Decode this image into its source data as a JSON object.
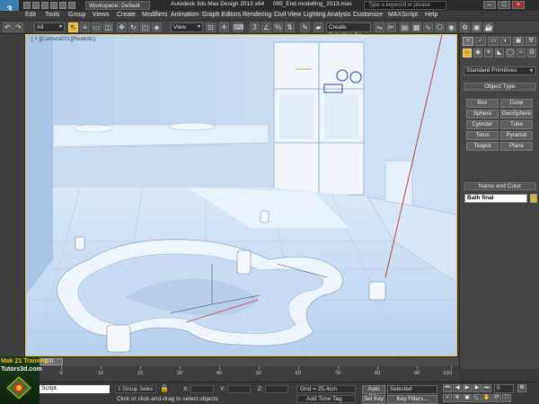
{
  "titlebar": {
    "logo": "3",
    "workspace": "Workspace: Default",
    "app_title": "Autodesk 3ds Max Design 2013 x64",
    "file_name": "095_End modelling_2013.max",
    "search_placeholder": "Type a keyword or phrase"
  },
  "menu": [
    "Edit",
    "Tools",
    "Group",
    "Views",
    "Create",
    "Modifiers",
    "Animation",
    "Graph Editors",
    "Rendering",
    "Civil View",
    "Lighting Analysis",
    "Customize",
    "MAXScript",
    "Help"
  ],
  "toolbar": {
    "filter": "All",
    "ref_coord": "View",
    "selection_set": "Create Selection Se"
  },
  "viewport": {
    "label": "[ + ][Camera001][Realistic]"
  },
  "command_panel": {
    "tabs": [
      "+",
      "⌐",
      "▭",
      "◐",
      "▣",
      "⚒"
    ],
    "category_icons": [
      "○",
      "◉",
      "☀",
      "◣",
      "◯",
      "≈",
      "⚙"
    ],
    "dropdown": "Standard Primitives",
    "object_type_title": "Object Type",
    "autogrid": "AutoGrid",
    "buttons": [
      [
        "Box",
        "Cone"
      ],
      [
        "Sphere",
        "GeoSphere"
      ],
      [
        "Cylinder",
        "Tube"
      ],
      [
        "Torus",
        "Pyramid"
      ],
      [
        "Teapot",
        "Plane"
      ]
    ],
    "name_color_title": "Name and Color",
    "object_name": "Bath final",
    "swatch_color": "#d9b23a"
  },
  "timeline": {
    "slider": "0 / 100",
    "ticks": [
      "0",
      "10",
      "20",
      "30",
      "40",
      "50",
      "60",
      "70",
      "80",
      "90",
      "100"
    ]
  },
  "status": {
    "maxscript": "Script.",
    "selection": "1 Group Selec",
    "x_label": "X:",
    "y_label": "Y:",
    "z_label": "Z:",
    "grid": "Grid = 25,4cm",
    "prompt": "Click or click-and-drag to select objects",
    "add_time_tag": "Add Time Tag",
    "auto_key": "Auto Key",
    "selected": "Selected",
    "set_key": "Set Key",
    "key_filters": "Key Filters...",
    "frame": "0"
  },
  "watermark": {
    "line1": "Mak 21 Training",
    "line2": "Tutors3d.com"
  }
}
